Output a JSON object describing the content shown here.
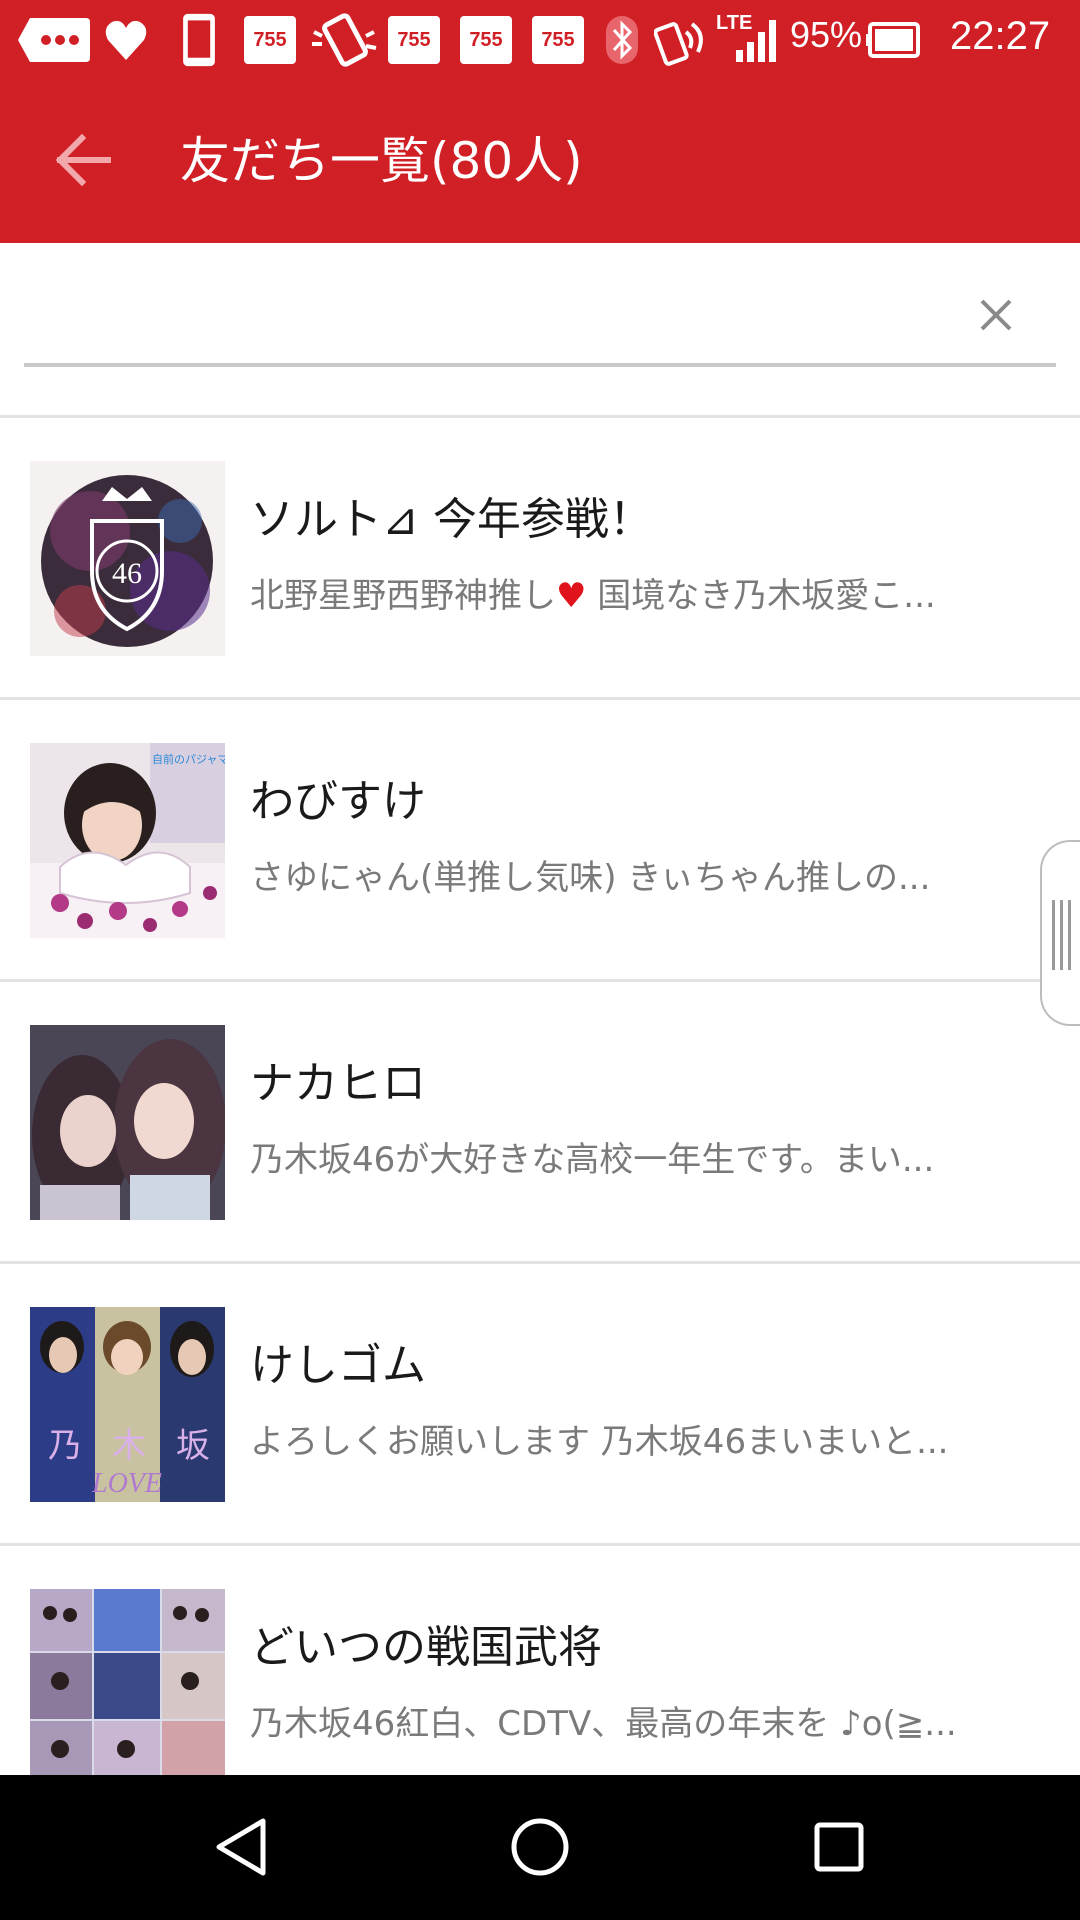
{
  "status_bar": {
    "app_badge_text": "755",
    "network_type": "LTE",
    "battery_percent": "95%",
    "time": "22:27",
    "icons": [
      "chat-bubble-icon",
      "heart-icon",
      "phone-icon",
      "755-app-icon",
      "vibrate-icon",
      "755-app-icon",
      "755-app-icon",
      "755-app-icon",
      "bluetooth-icon",
      "nfc-icon",
      "signal-icon",
      "battery-icon"
    ]
  },
  "toolbar": {
    "title": "友だち一覧(80人)",
    "back_icon": "arrow-left-icon"
  },
  "search": {
    "value": "",
    "placeholder": "",
    "clear_icon": "close-icon"
  },
  "friends": [
    {
      "name": "ソルト⊿ 今年参戦！",
      "bio_a": "北野星野西野神推し",
      "bio_heart": "♥",
      "bio_b": " 国境なき乃木坂愛こ..."
    },
    {
      "name": "わびすけ",
      "bio": "さゆにゃん(単推し気味) きぃちゃん推しの..."
    },
    {
      "name": "ナカヒロ",
      "bio": "乃木坂46が大好きな高校一年生です。まい..."
    },
    {
      "name": "けしゴム",
      "bio": "よろしくお願いします 乃木坂46まいまいと..."
    },
    {
      "name": "どいつの戦国武将",
      "bio": "乃木坂46紅白、CDTV、最高の年末を ♪o(≧..."
    }
  ],
  "avatar_texts": {
    "badge": "46",
    "caption": "自前のパジャマで",
    "kanji": [
      "乃",
      "木",
      "坂"
    ],
    "love": "LOVE"
  },
  "nav_bar": {
    "back_icon": "triangle-back-icon",
    "home_icon": "circle-home-icon",
    "recents_icon": "square-recents-icon"
  },
  "colors": {
    "accent": "#d11f26",
    "heart": "#e0121b",
    "name_text": "#1a1a1a",
    "bio_text": "#7a7a7a"
  }
}
